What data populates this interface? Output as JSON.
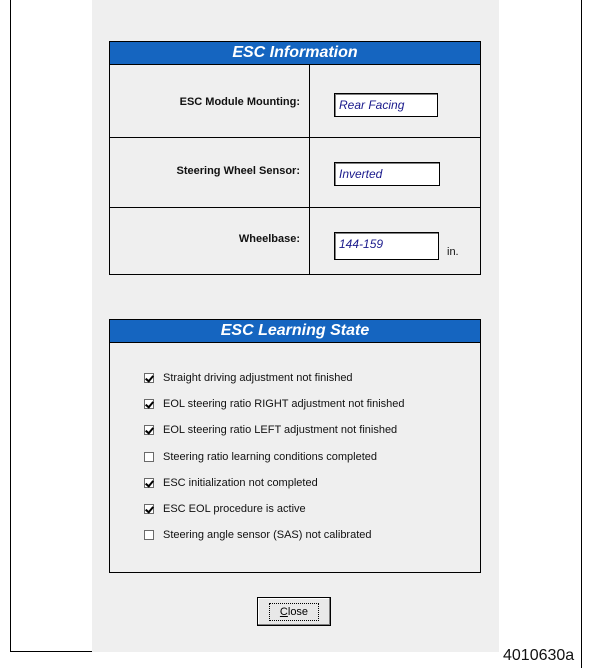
{
  "esc_information": {
    "title": "ESC Information",
    "rows": [
      {
        "label": "ESC Module Mounting:",
        "value": "Rear Facing",
        "unit": ""
      },
      {
        "label": "Steering Wheel Sensor:",
        "value": "Inverted",
        "unit": ""
      },
      {
        "label": "Wheelbase:",
        "value": "144-159",
        "unit": "in."
      }
    ]
  },
  "esc_learning_state": {
    "title": "ESC Learning State",
    "items": [
      {
        "label": "Straight driving adjustment not finished",
        "checked": true
      },
      {
        "label": "EOL steering ratio RIGHT adjustment not finished",
        "checked": true
      },
      {
        "label": "EOL steering ratio LEFT adjustment not finished",
        "checked": true
      },
      {
        "label": "Steering ratio learning conditions completed",
        "checked": false
      },
      {
        "label": "ESC initialization not completed",
        "checked": true
      },
      {
        "label": "ESC EOL procedure is active",
        "checked": true
      },
      {
        "label": "Steering angle sensor (SAS) not calibrated",
        "checked": false
      }
    ]
  },
  "close_button": {
    "label_mnemonic": "C",
    "label_rest": "lose"
  },
  "figure_id": "4010630a",
  "colors": {
    "header_bg": "#1565c0",
    "value_text": "#1a1a8c",
    "dialog_bg": "#efefef"
  }
}
